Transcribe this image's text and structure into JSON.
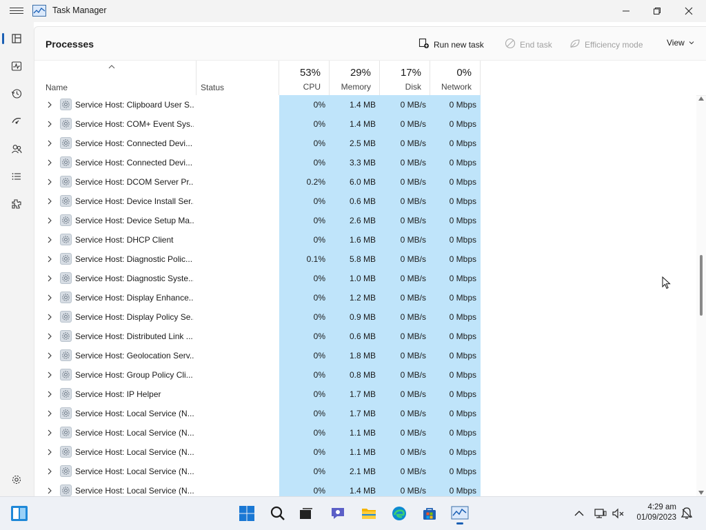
{
  "window": {
    "title": "Task Manager"
  },
  "page": {
    "title": "Processes",
    "toolbar": {
      "run_new_task": "Run new task",
      "end_task": "End task",
      "efficiency_mode": "Efficiency mode",
      "view": "View"
    }
  },
  "columns": {
    "name": "Name",
    "status": "Status",
    "cpu": {
      "pct": "53%",
      "label": "CPU"
    },
    "memory": {
      "pct": "29%",
      "label": "Memory"
    },
    "disk": {
      "pct": "17%",
      "label": "Disk"
    },
    "network": {
      "pct": "0%",
      "label": "Network"
    }
  },
  "rows": [
    {
      "name": "Service Host: Clipboard User S...",
      "cpu": "0%",
      "mem": "1.4 MB",
      "disk": "0 MB/s",
      "net": "0 Mbps"
    },
    {
      "name": "Service Host: COM+ Event Sys...",
      "cpu": "0%",
      "mem": "1.4 MB",
      "disk": "0 MB/s",
      "net": "0 Mbps"
    },
    {
      "name": "Service Host: Connected Devi...",
      "cpu": "0%",
      "mem": "2.5 MB",
      "disk": "0 MB/s",
      "net": "0 Mbps"
    },
    {
      "name": "Service Host: Connected Devi...",
      "cpu": "0%",
      "mem": "3.3 MB",
      "disk": "0 MB/s",
      "net": "0 Mbps"
    },
    {
      "name": "Service Host: DCOM Server Pr...",
      "cpu": "0.2%",
      "mem": "6.0 MB",
      "disk": "0 MB/s",
      "net": "0 Mbps"
    },
    {
      "name": "Service Host: Device Install Ser...",
      "cpu": "0%",
      "mem": "0.6 MB",
      "disk": "0 MB/s",
      "net": "0 Mbps"
    },
    {
      "name": "Service Host: Device Setup Ma...",
      "cpu": "0%",
      "mem": "2.6 MB",
      "disk": "0 MB/s",
      "net": "0 Mbps"
    },
    {
      "name": "Service Host: DHCP Client",
      "cpu": "0%",
      "mem": "1.6 MB",
      "disk": "0 MB/s",
      "net": "0 Mbps"
    },
    {
      "name": "Service Host: Diagnostic Polic...",
      "cpu": "0.1%",
      "mem": "5.8 MB",
      "disk": "0 MB/s",
      "net": "0 Mbps"
    },
    {
      "name": "Service Host: Diagnostic Syste...",
      "cpu": "0%",
      "mem": "1.0 MB",
      "disk": "0 MB/s",
      "net": "0 Mbps"
    },
    {
      "name": "Service Host: Display Enhance...",
      "cpu": "0%",
      "mem": "1.2 MB",
      "disk": "0 MB/s",
      "net": "0 Mbps"
    },
    {
      "name": "Service Host: Display Policy Se...",
      "cpu": "0%",
      "mem": "0.9 MB",
      "disk": "0 MB/s",
      "net": "0 Mbps"
    },
    {
      "name": "Service Host: Distributed Link ...",
      "cpu": "0%",
      "mem": "0.6 MB",
      "disk": "0 MB/s",
      "net": "0 Mbps"
    },
    {
      "name": "Service Host: Geolocation Serv...",
      "cpu": "0%",
      "mem": "1.8 MB",
      "disk": "0 MB/s",
      "net": "0 Mbps"
    },
    {
      "name": "Service Host: Group Policy Cli...",
      "cpu": "0%",
      "mem": "0.8 MB",
      "disk": "0 MB/s",
      "net": "0 Mbps"
    },
    {
      "name": "Service Host: IP Helper",
      "cpu": "0%",
      "mem": "1.7 MB",
      "disk": "0 MB/s",
      "net": "0 Mbps"
    },
    {
      "name": "Service Host: Local Service (N...",
      "cpu": "0%",
      "mem": "1.7 MB",
      "disk": "0 MB/s",
      "net": "0 Mbps"
    },
    {
      "name": "Service Host: Local Service (N...",
      "cpu": "0%",
      "mem": "1.1 MB",
      "disk": "0 MB/s",
      "net": "0 Mbps"
    },
    {
      "name": "Service Host: Local Service (N...",
      "cpu": "0%",
      "mem": "1.1 MB",
      "disk": "0 MB/s",
      "net": "0 Mbps"
    },
    {
      "name": "Service Host: Local Service (N...",
      "cpu": "0%",
      "mem": "2.1 MB",
      "disk": "0 MB/s",
      "net": "0 Mbps"
    },
    {
      "name": "Service Host: Local Service (N...",
      "cpu": "0%",
      "mem": "1.4 MB",
      "disk": "0 MB/s",
      "net": "0 Mbps"
    }
  ],
  "taskbar": {
    "time": "4:29 am",
    "date": "01/09/2023",
    "icons": [
      "widgets-icon",
      "start-icon",
      "search-icon",
      "task-view-icon",
      "chat-icon",
      "file-explorer-icon",
      "edge-icon",
      "store-icon",
      "task-manager-icon"
    ]
  },
  "colors": {
    "heat_band": "#bfe4fa",
    "accent": "#1a5fb4"
  }
}
